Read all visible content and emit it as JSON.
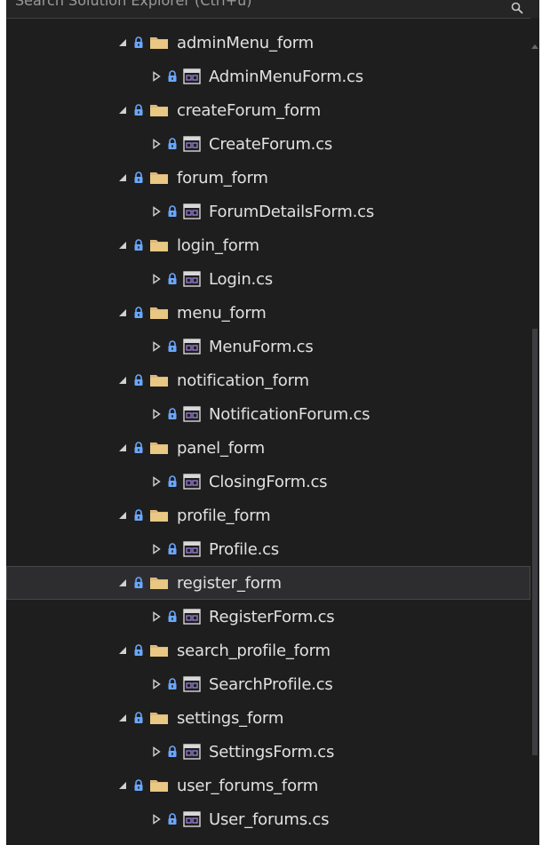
{
  "panel": {
    "search_placeholder": "Search Solution Explorer (Ctrl+ü)"
  },
  "colors": {
    "background": "#1e1e1e",
    "text": "#e1e1e1",
    "folder": "#dcb67a",
    "lock": "#6aa7ff",
    "form_icon": "#9b82d6",
    "selected_row": "#2d2d30"
  },
  "tree": [
    {
      "folder": "adminMenu_form",
      "file": "AdminMenuForm.cs"
    },
    {
      "folder": "createForum_form",
      "file": "CreateForum.cs"
    },
    {
      "folder": "forum_form",
      "file": "ForumDetailsForm.cs"
    },
    {
      "folder": "login_form",
      "file": "Login.cs"
    },
    {
      "folder": "menu_form",
      "file": "MenuForm.cs"
    },
    {
      "folder": "notification_form",
      "file": "NotificationForum.cs"
    },
    {
      "folder": "panel_form",
      "file": "ClosingForm.cs"
    },
    {
      "folder": "profile_form",
      "file": "Profile.cs"
    },
    {
      "folder": "register_form",
      "file": "RegisterForm.cs",
      "selected": true
    },
    {
      "folder": "search_profile_form",
      "file": "SearchProfile.cs"
    },
    {
      "folder": "settings_form",
      "file": "SettingsForm.cs"
    },
    {
      "folder": "user_forums_form",
      "file": "User_forums.cs"
    }
  ]
}
